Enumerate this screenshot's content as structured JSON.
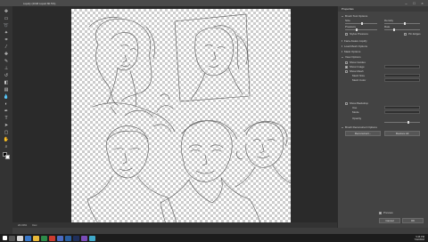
{
  "window": {
    "title": "Liquify (2048 Liquid 80.5%)",
    "min": "–",
    "max": "□",
    "close": "×"
  },
  "tools": [
    "move",
    "marquee",
    "lasso",
    "wand",
    "crop",
    "eyedropper",
    "heal",
    "brush",
    "stamp",
    "history",
    "eraser",
    "gradient",
    "blur",
    "dodge",
    "pen",
    "type",
    "path",
    "shape",
    "hand",
    "zoom"
  ],
  "status": {
    "zoom": "20.09%",
    "doc": "Doc"
  },
  "panel": {
    "header": "Properties",
    "brush_tool_options": "Brush Tool Options",
    "size": "Size",
    "density": "Density",
    "pressure": "Pressure",
    "rate": "Rate",
    "stylus_pressure": "Stylus Pressure",
    "pin_edges": "Pin Edges",
    "face_aware": "Face-Aware Liquify",
    "load_mesh": "Load Mesh Options",
    "mask_options": "Mask Options",
    "view_options": "View Options",
    "show_guides": "Show Guides",
    "show_image": "Show Image",
    "show_mesh": "Show Mesh",
    "mesh_size": "Mesh Size",
    "mesh_color": "Mesh Color",
    "show_backdrop": "Show Backdrop",
    "use": "Use",
    "mode": "Mode",
    "opacity": "Opacity",
    "brush_reconstruct": "Brush Reconstruct Options",
    "reconstruct": "Reconstruct...",
    "restore_all": "Restore All",
    "preview": "Preview",
    "cancel": "Cancel",
    "ok": "OK"
  },
  "taskbar": {
    "time": "5:46 PM",
    "date": "7/12/2018"
  },
  "colors": {
    "foreground": "#000000",
    "background": "#ffffff",
    "accent": "#2f80d0"
  }
}
